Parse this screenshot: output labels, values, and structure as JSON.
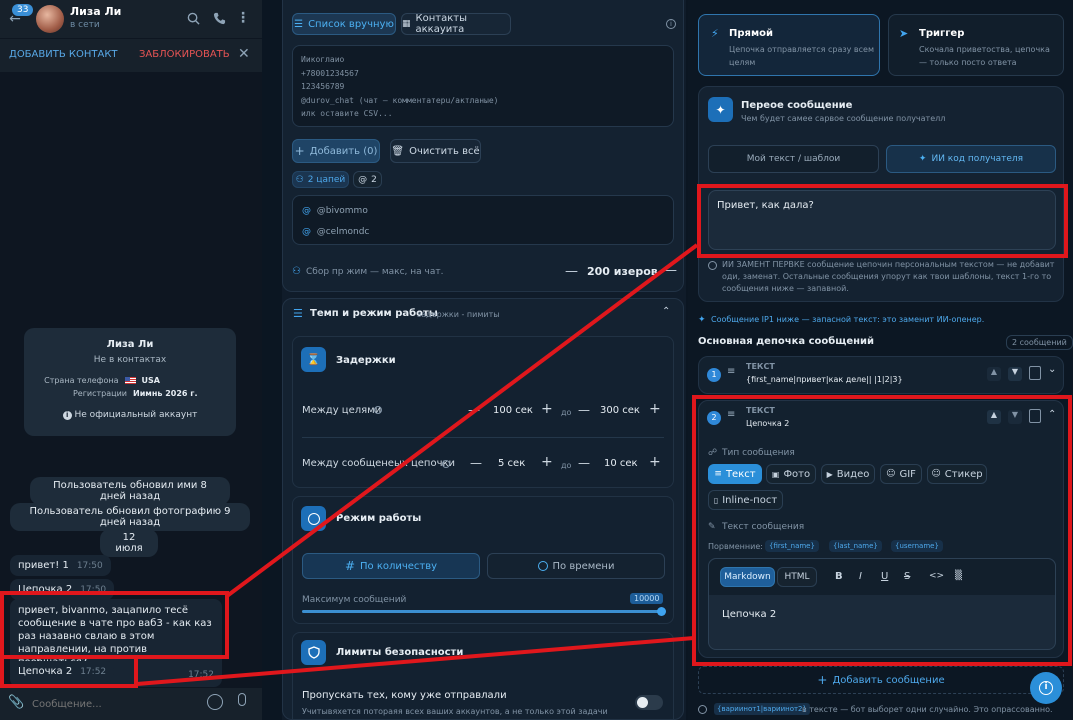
{
  "chat": {
    "unread": "33",
    "name": "Лиза Ли",
    "status": "в сети",
    "add_contact": "ДОБАВИТЬ КОНТАКТ",
    "block": "ЗАБЛОКИРОВАТЬ",
    "profile": {
      "name": "Лиза Ли",
      "subtitle": "Не в контактах",
      "phone_label": "Страна телефона",
      "phone_value": "USA",
      "reg_label": "Регистрации",
      "reg_value": "Иимнь 2026 г.",
      "official": "Не официальный аккаунт"
    },
    "service": [
      "Пользователь обновил ими 8 дней назад",
      "Пользователь обновил фотографию 9 дней назад",
      "12 июля"
    ],
    "messages": [
      {
        "text": "привет! 1",
        "time": "17:50"
      },
      {
        "text": "Цепочка 2",
        "time": "17:50"
      },
      {
        "text": "привет, bivanmo, зацапило тесё сообщение в чате про ваб3 - как каз раз назавно свлаю в этом направлении, на против пообщаться?",
        "time": "17:52"
      },
      {
        "text": "Цепочка 2",
        "time": "17:52"
      }
    ],
    "input_placeholder": "Сообщение..."
  },
  "mid": {
    "tab_manual": "Список вручную",
    "tab_contacts": "Контакты аккауита",
    "textarea_lines": [
      "Иикоглаио",
      "+78001234567",
      "123456789",
      "@durov_chat (чат — комментатерu/актланые)",
      "илк оставите CSV..."
    ],
    "add_btn": "Добавить (0)",
    "clear_btn": "Очистить всё",
    "tag_targets": "2 цапей",
    "tag_count": "2",
    "targets": [
      "@bivommo",
      "@celmondc"
    ],
    "collect_label": "Сбор пр жим — макс, на чат.",
    "collect_value": "200 изеров",
    "tempo_title": "Темп и режим работы",
    "tempo_sub": "задержки - пимиты",
    "delays_title": "Задержки",
    "between_targets": "Между целями",
    "between_targets_from": "100 сек",
    "between_targets_to": "300 сек",
    "between_msgs": "Между сообщенеых цепочки",
    "between_msgs_from": "5 сек",
    "between_msgs_to": "10 сек",
    "to_word": "до",
    "mode_title": "Режим работы",
    "mode_count": "По количеству",
    "mode_time": "По времени",
    "max_msgs_label": "Максимум сообщений",
    "max_msgs_value": "10000",
    "max_msgs_fill": 1.0,
    "limits_title": "Лимиты безопасности",
    "skip_title": "Пропускать тех, кому уже отправлали",
    "skip_sub": "Учитывяхется потораяя всех ваших аккаунтов, а не только этой задачи"
  },
  "right": {
    "direct_title": "Прямой",
    "direct_desc": "Цепочка отправляется сразу всем целям",
    "trigger_title": "Триггер",
    "trigger_desc": "Скочала приветоства, цепочка — только посто ответа",
    "first_title": "Переое сообщение",
    "first_sub": "Чем будет самее сарвое сообщение получателл",
    "own_text": "Мой текст / шаблои",
    "ai_code": "ИИ код получателя",
    "greeting": "Привет, как дала?",
    "ai_note": "ИИ ЗАМЕНТ ПЕРВКЕ сообщение цепочин персональным текстом — не добавит оди, заменат. Остальные сообщения упорут как твои шаблоны, текст 1-го то сообщения ниже — запавной.",
    "fallback_note": "Сообщение ІР1 ниже — запасной текст: это заменит ИИ-опенер.",
    "chain_title": "Основная депочка сообщений",
    "chain_count": "2 сообщений",
    "items": [
      {
        "num": "1",
        "type": "ТЕКСТ",
        "text": "{first_name|привет|как деле|| |1|2|3}"
      },
      {
        "num": "2",
        "type": "ТЕКСТ",
        "text": "Цепочка 2"
      }
    ],
    "msg_type_label": "Тип сообщения",
    "types": [
      "Текст",
      "Фото",
      "Видео",
      "GIF",
      "Стикер",
      "Inline-пост"
    ],
    "msg_text_label": "Текст сообщения",
    "vars_label": "Порвменние:",
    "vars": [
      "{first_name}",
      "{last_name}",
      "{username}"
    ],
    "markdown": "Markdown",
    "html": "HTML",
    "editor_text": "Цепочка 2",
    "add_msg": "Добавить сообщение",
    "bottom_note_var": "{вариинот1|вариинот2}",
    "bottom_note": "в тексте — бот выборет одни случайно. Это опрассованно."
  },
  "colors": {
    "accent": "#2f9be6",
    "red": "#e0171c",
    "bg": "#0b1622"
  }
}
